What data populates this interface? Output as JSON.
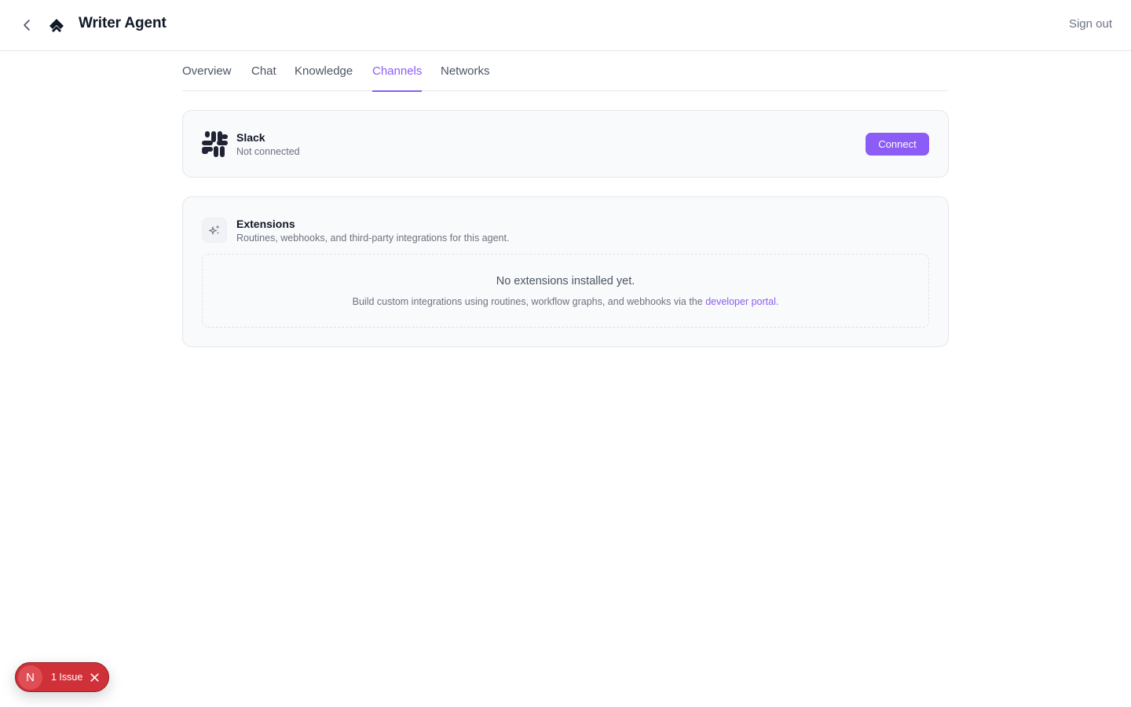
{
  "header": {
    "title": "Writer Agent",
    "sign_out_label": "Sign out"
  },
  "tabs": [
    {
      "label": "Overview",
      "active": false
    },
    {
      "label": "Chat",
      "active": false
    },
    {
      "label": "Knowledge",
      "active": false
    },
    {
      "label": "Channels",
      "active": true
    },
    {
      "label": "Networks",
      "active": false
    }
  ],
  "slack": {
    "name": "Slack",
    "status": "Not connected",
    "connect_label": "Connect"
  },
  "extensions": {
    "title": "Extensions",
    "subtitle": "Routines, webhooks, and third-party integrations for this agent.",
    "empty_title": "No extensions installed yet.",
    "empty_desc_prefix": "Build custom integrations using routines, workflow graphs, and webhooks via the ",
    "empty_desc_link": "developer portal",
    "empty_desc_suffix": "."
  },
  "issue_badge": {
    "avatar_letter": "N",
    "label": "1 Issue"
  },
  "colors": {
    "accent": "#8b5cf6",
    "issue": "#d03138"
  },
  "icons": [
    "chevron-left-icon",
    "brand-logo-icon",
    "slack-logo-icon",
    "sparkles-icon",
    "close-icon"
  ]
}
